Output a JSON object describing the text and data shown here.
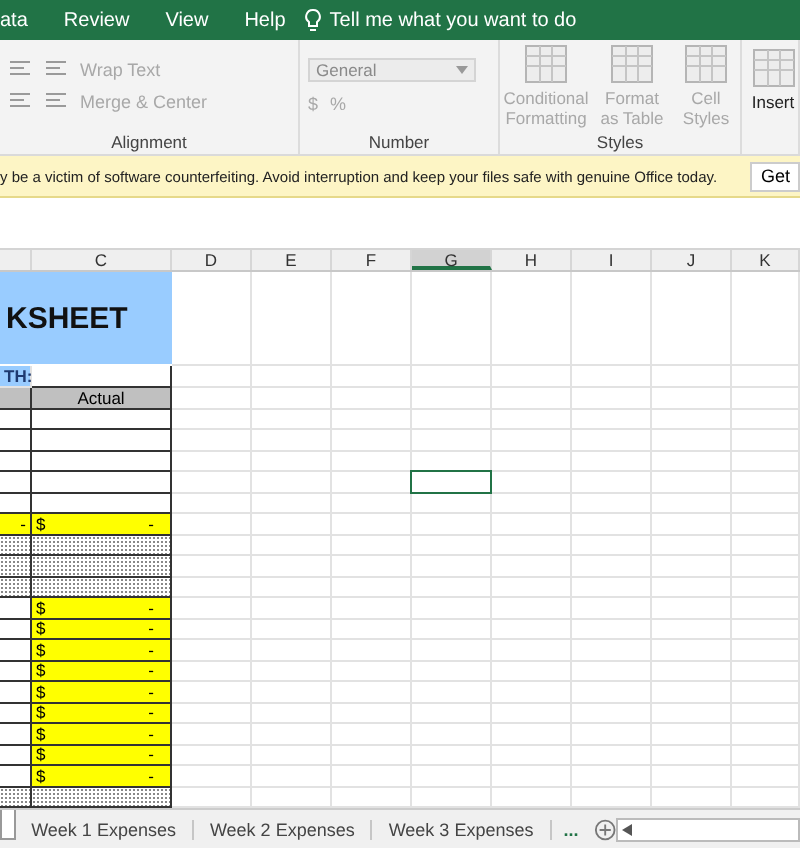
{
  "ribbon_tabs": [
    {
      "label": "ata"
    },
    {
      "label": "Review"
    },
    {
      "label": "View"
    },
    {
      "label": "Help"
    }
  ],
  "tell_me": "Tell me what you want to do",
  "ribbon_groups": [
    {
      "kind": "alignment",
      "label": "Alignment",
      "disabled": true,
      "commands": [
        "Wrap Text",
        "Merge & Center"
      ]
    },
    {
      "kind": "number",
      "label": "Number",
      "disabled": true,
      "format": "General",
      "commands": [
        "$",
        "%"
      ]
    },
    {
      "kind": "styles",
      "label": "Styles",
      "disabled": true,
      "commands": [
        "Conditional Formatting",
        "Format as Table",
        "Cell Styles"
      ]
    },
    {
      "kind": "cells",
      "disabled": false,
      "commands": [
        "Insert"
      ]
    }
  ],
  "notice": {
    "message": "y be a victim of software counterfeiting. Avoid interruption and keep your files safe with genuine Office today.",
    "button": "Get"
  },
  "columns": [
    {
      "label": "C",
      "selected": false
    },
    {
      "label": "D",
      "selected": false
    },
    {
      "label": "E",
      "selected": false
    },
    {
      "label": "F",
      "selected": false
    },
    {
      "label": "G",
      "selected": true
    },
    {
      "label": "H",
      "selected": false
    },
    {
      "label": "I",
      "selected": false
    },
    {
      "label": "J",
      "selected": false
    },
    {
      "label": "K",
      "selected": false
    }
  ],
  "rows": [
    {
      "kind": "title",
      "text": "KSHEET",
      "selected": false
    },
    {
      "kind": "label",
      "text": "TH:",
      "selected": false
    },
    {
      "kind": "header",
      "text": "Actual",
      "selected": false
    },
    {
      "kind": "blank",
      "selected": false
    },
    {
      "kind": "blank",
      "selected": false
    },
    {
      "kind": "blank",
      "selected": false
    },
    {
      "kind": "blank",
      "selected": true
    },
    {
      "kind": "blank",
      "selected": false
    },
    {
      "kind": "total",
      "text": "-",
      "currency": "$",
      "amount": "-",
      "selected": false
    },
    {
      "kind": "dotted",
      "selected": false
    },
    {
      "kind": "dotted",
      "selected": false
    },
    {
      "kind": "dotted",
      "selected": false
    },
    {
      "kind": "amount",
      "currency": "$",
      "amount": "-",
      "selected": false
    },
    {
      "kind": "amount",
      "currency": "$",
      "amount": "-",
      "selected": false
    },
    {
      "kind": "amount",
      "currency": "$",
      "amount": "-",
      "selected": false
    },
    {
      "kind": "amount",
      "currency": "$",
      "amount": "-",
      "selected": false
    },
    {
      "kind": "amount",
      "currency": "$",
      "amount": "-",
      "selected": false
    },
    {
      "kind": "amount",
      "currency": "$",
      "amount": "-",
      "selected": false
    },
    {
      "kind": "amount",
      "currency": "$",
      "amount": "-",
      "selected": false
    },
    {
      "kind": "amount",
      "currency": "$",
      "amount": "-",
      "selected": false
    },
    {
      "kind": "amount",
      "currency": "$",
      "amount": "-",
      "selected": false
    },
    {
      "kind": "dotted",
      "selected": false
    }
  ],
  "sheet_tabs": [
    {
      "label": "Week 1 Expenses",
      "selected": false
    },
    {
      "label": "Week 2 Expenses",
      "selected": false
    },
    {
      "label": "Week 3 Expenses",
      "selected": false
    }
  ],
  "more_tabs": "..."
}
